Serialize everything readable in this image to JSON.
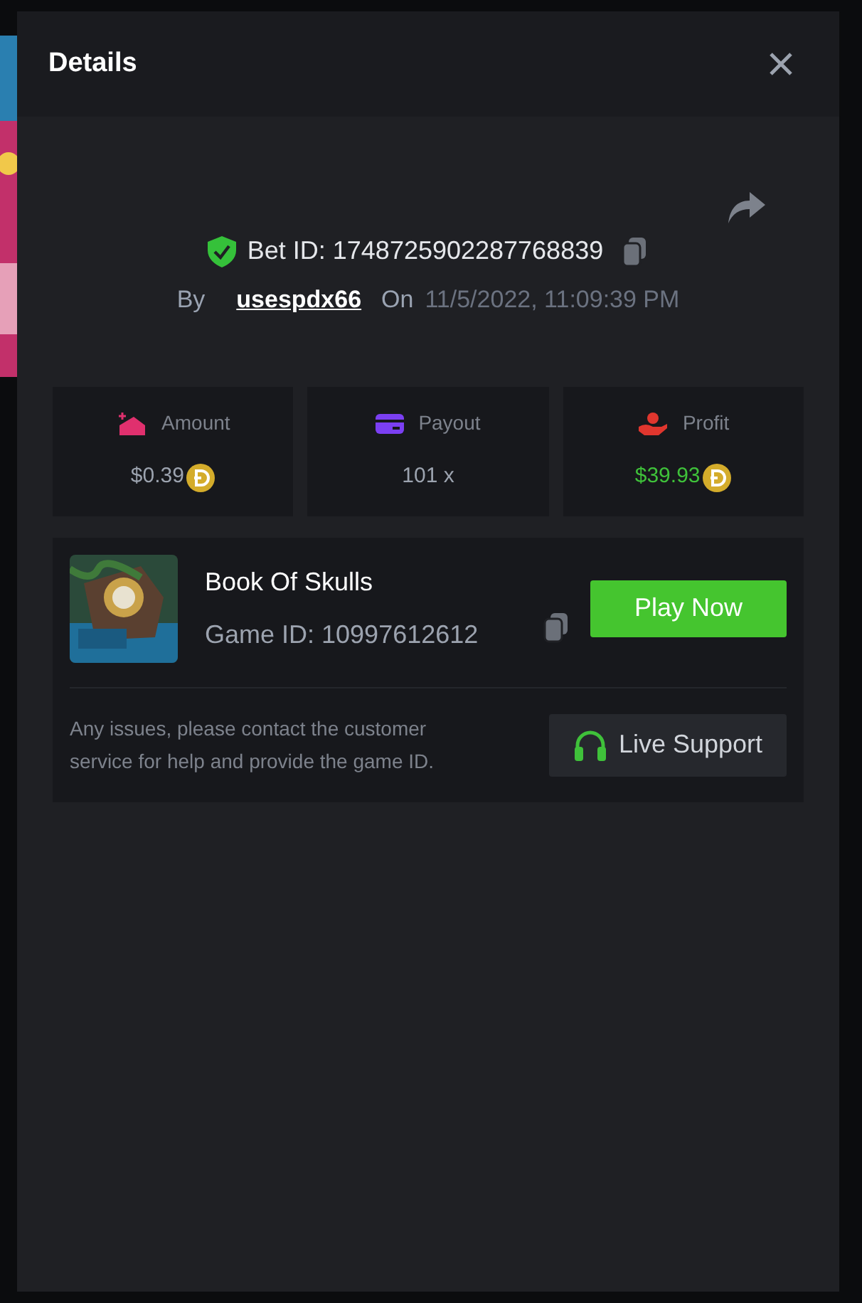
{
  "dialog": {
    "title": "Details"
  },
  "bet": {
    "verified": true,
    "label": "Bet ID: 1748725902287768839",
    "by_label": "By",
    "user": "usespdx66",
    "on_label": "On",
    "time": "11/5/2022, 11:09:39 PM"
  },
  "stats": [
    {
      "kind": "amount",
      "label": "Amount",
      "value": "$0.39",
      "coin": true,
      "color": "#e0306e",
      "positive": false
    },
    {
      "kind": "payout",
      "label": "Payout",
      "value": "101 x",
      "coin": false,
      "color": "#7b3ff2",
      "positive": false
    },
    {
      "kind": "profit",
      "label": "Profit",
      "value": "$39.93",
      "coin": true,
      "color": "#e0362e",
      "positive": true
    }
  ],
  "game": {
    "name": "Book Of Skulls",
    "id_label": "Game ID: 10997612612",
    "play_button": "Play Now",
    "help_text": "Any issues, please contact the customer service for help and provide the game ID.",
    "support_button": "Live Support"
  }
}
